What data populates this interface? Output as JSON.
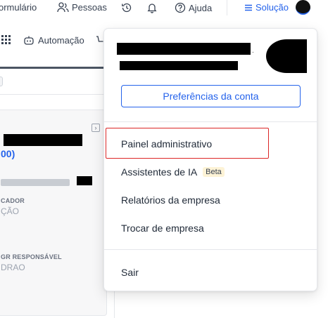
{
  "topbar": {
    "formulario_label": "ormulário",
    "pessoas_label": "Pessoas",
    "ajuda_label": "Ajuda",
    "solucao_label": "Solução"
  },
  "toolbar": {
    "automacao_label": "Automação"
  },
  "card": {
    "code_text": "00)",
    "field1_label": "CADOR",
    "field1_value": "ÇÃO",
    "field2_label": "GR RESPONSÁVEL",
    "field2_value": "DRAO"
  },
  "dropdown": {
    "account_prefs_label": "Preferências da conta",
    "items": [
      {
        "label": "Painel administrativo"
      },
      {
        "label": "Assistentes de IA",
        "badge": "Beta"
      },
      {
        "label": "Relatórios da empresa"
      },
      {
        "label": "Trocar de empresa"
      },
      {
        "label": "Sair"
      }
    ]
  },
  "colors": {
    "accent": "#2563eb",
    "highlight_border": "#dc2626",
    "beta_bg": "#fdf3d6"
  }
}
